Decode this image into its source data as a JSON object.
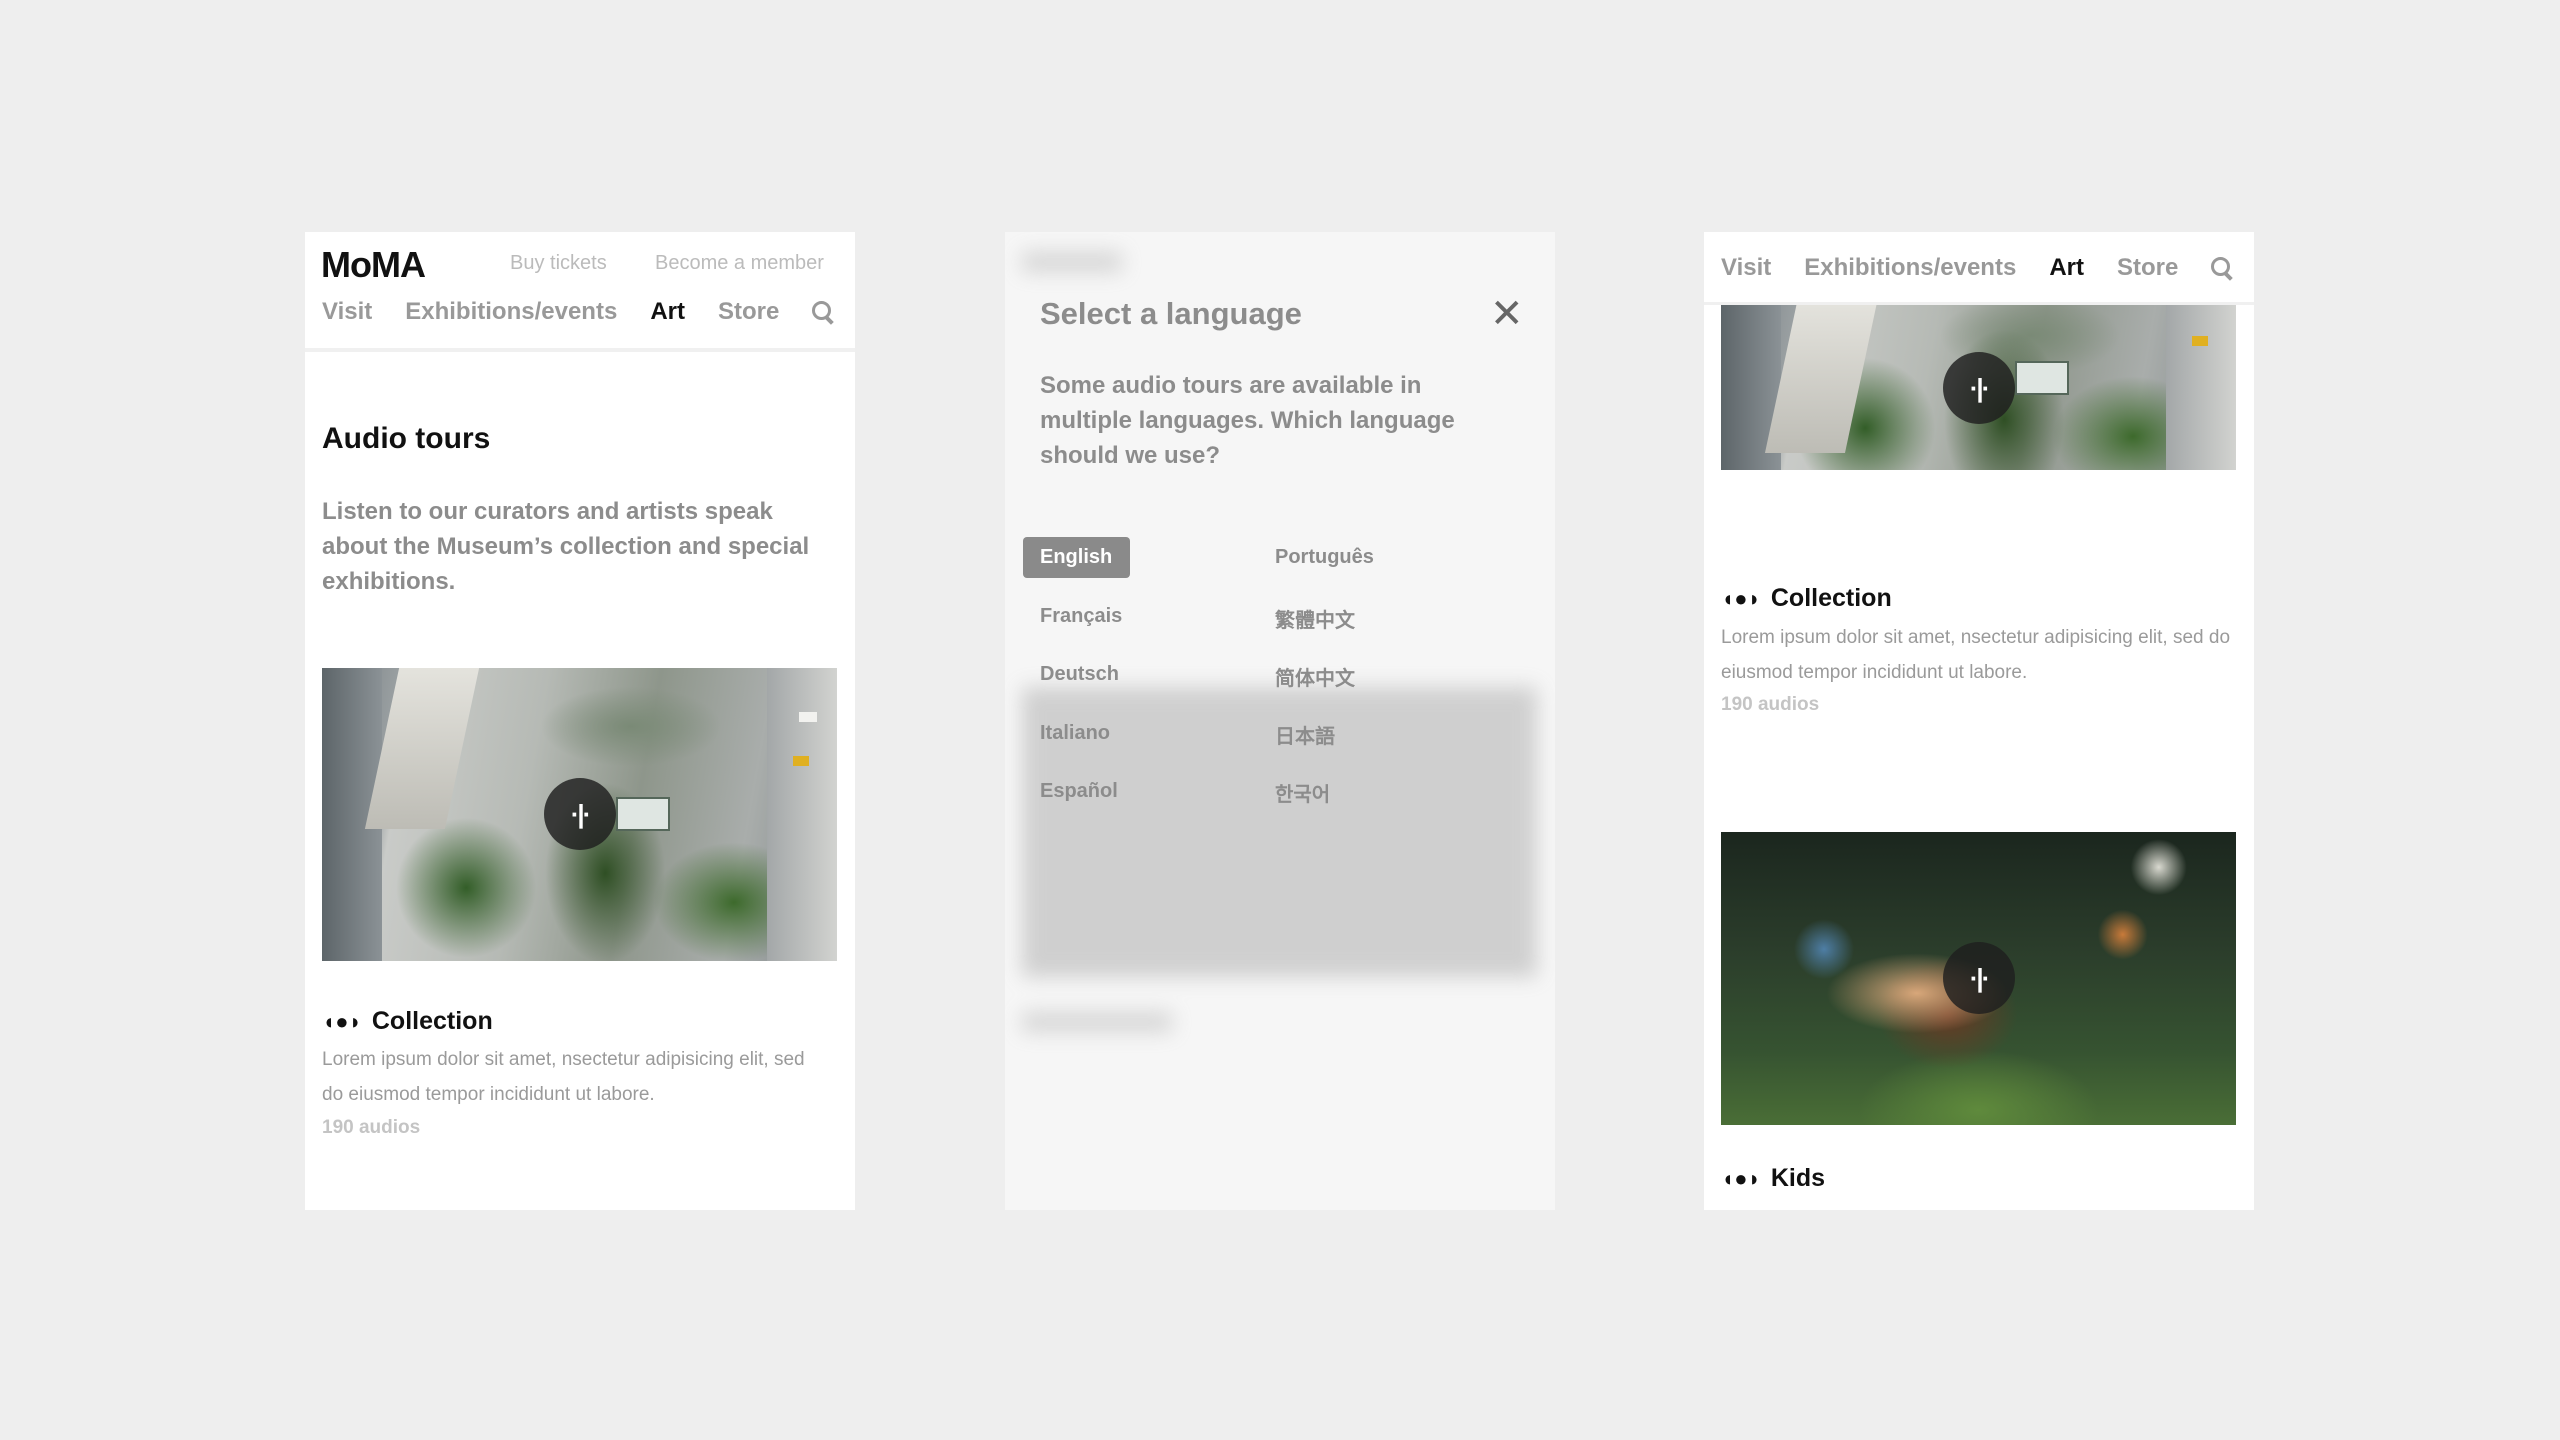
{
  "screen1": {
    "logo": "MoMA",
    "util_links": [
      "Buy tickets",
      "Become a member"
    ],
    "nav": [
      "Visit",
      "Exhibitions/events",
      "Art",
      "Store"
    ],
    "nav_active": "Art",
    "title": "Audio tours",
    "lead": "Listen to our curators and artists speak about the Museum’s collection and special exhibitions.",
    "card": {
      "title": "Collection",
      "desc": "Lorem ipsum dolor sit amet, nsectetur adipisicing elit, sed do eiusmod tempor incididunt ut labore.",
      "count": "190 audios"
    }
  },
  "screen2": {
    "modal_title": "Select a language",
    "modal_text": "Some audio tours are available in multiple languages. Which language should we use?",
    "languages_col1": [
      "English",
      "Français",
      "Deutsch",
      "Italiano",
      "Español"
    ],
    "languages_col2": [
      "Português",
      "繁體中文",
      "简体中文",
      "日本語",
      "한국어"
    ],
    "selected": "English"
  },
  "screen3": {
    "nav": [
      "Visit",
      "Exhibitions/events",
      "Art",
      "Store"
    ],
    "card1": {
      "title": "Collection",
      "desc": "Lorem ipsum dolor sit amet, nsectetur adipisicing elit, sed do eiusmod tempor incididunt ut labore.",
      "count": "190 audios"
    },
    "card2": {
      "title": "Kids"
    }
  },
  "icons": {
    "search": "search-icon",
    "play": "audio-play-icon",
    "headphones": "headphones-icon",
    "close": "close-icon"
  },
  "colors": {
    "background": "#eeeeee",
    "text": "#111111",
    "muted": "#8c8c8c",
    "selected": "#8a8a8a"
  }
}
